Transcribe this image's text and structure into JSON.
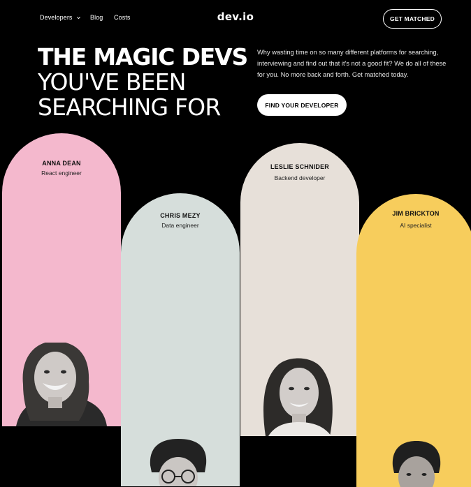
{
  "nav": {
    "developers_label": "Developers",
    "blog_label": "Blog",
    "costs_label": "Costs",
    "logo": "dev.io",
    "cta_label": "GET MATCHED"
  },
  "hero": {
    "line1": "THE MAGIC DEVS",
    "line2": "YOU'VE BEEN",
    "line3": "SEARCHING FOR",
    "description": "Why wasting time on so many different platforms for searching, interviewing and find out that it's not a good fit? We do all of these for you. No more back and forth. Get matched today.",
    "cta_label": "FIND YOUR DEVELOPER"
  },
  "developers": [
    {
      "name": "ANNA DEAN",
      "role": "React engineer",
      "color": "#f4b8cd"
    },
    {
      "name": "CHRIS MEZY",
      "role": "Data engineer",
      "color": "#d6dedb"
    },
    {
      "name": "LESLIE SCHNIDER",
      "role": "Backend developer",
      "color": "#e7e0d9"
    },
    {
      "name": "JIM BRICKTON",
      "role": "AI specialist",
      "color": "#f7cd5c"
    }
  ]
}
